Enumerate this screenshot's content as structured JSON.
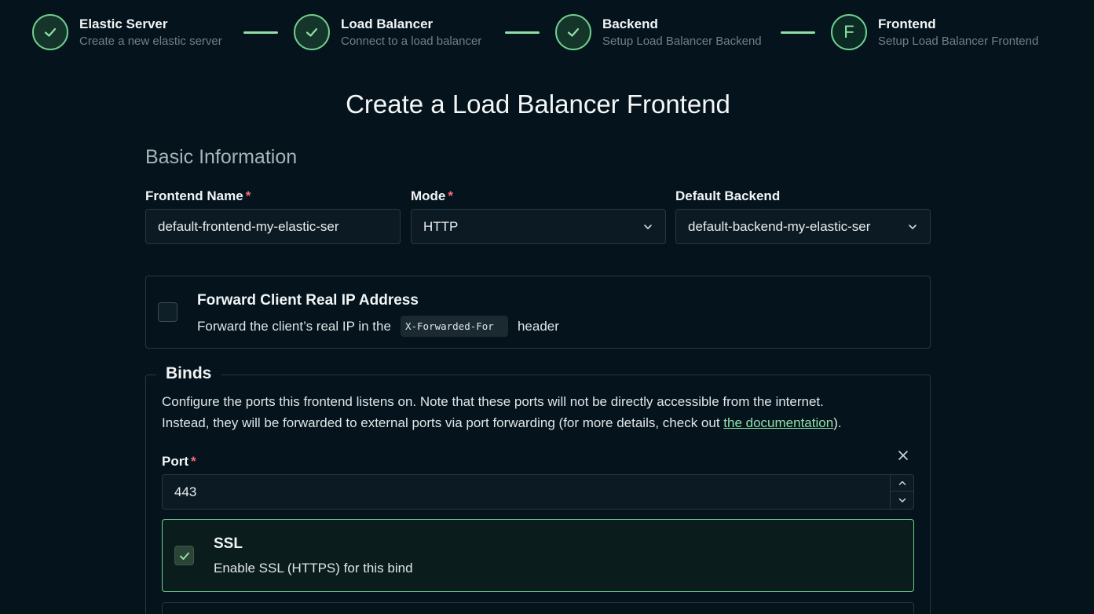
{
  "stepper": {
    "steps": [
      {
        "title": "Elastic Server",
        "subtitle": "Create a new elastic server",
        "state": "complete",
        "icon": "check-icon"
      },
      {
        "title": "Load Balancer",
        "subtitle": "Connect to a load balancer",
        "state": "complete",
        "icon": "check-icon"
      },
      {
        "title": "Backend",
        "subtitle": "Setup Load Balancer Backend",
        "state": "complete",
        "icon": "check-icon"
      },
      {
        "title": "Frontend",
        "subtitle": "Setup Load Balancer Frontend",
        "state": "current",
        "letter": "F"
      }
    ]
  },
  "page": {
    "title": "Create a Load Balancer Frontend",
    "section_title": "Basic Information"
  },
  "form": {
    "frontend_name": {
      "label": "Frontend Name",
      "required": "*",
      "value": "default-frontend-my-elastic-ser"
    },
    "mode": {
      "label": "Mode",
      "required": "*",
      "value": "HTTP"
    },
    "default_backend": {
      "label": "Default Backend",
      "value": "default-backend-my-elastic-ser"
    }
  },
  "forward_ip": {
    "title": "Forward Client Real IP Address",
    "desc_before": "Forward the client’s real IP in the",
    "code": "X-Forwarded-For",
    "desc_after": "header",
    "checked": false
  },
  "binds": {
    "legend": "Binds",
    "desc_line1": "Configure the ports this frontend listens on. Note that these ports will not be directly accessible from the internet.",
    "desc_line2": "Instead, they will be forwarded to external ports via port forwarding (for more details, check out ",
    "link_text": "the documentation",
    "desc_end": ").",
    "port_label": "Port",
    "port_required": "*",
    "port_value": "443",
    "ssl_title": "SSL",
    "ssl_desc": "Enable SSL (HTTPS) for this bind",
    "ssl_checked": true
  },
  "colors": {
    "background": "#04131c",
    "accent": "#8fe0a8",
    "required": "#ff6b7a",
    "border": "#283840"
  }
}
